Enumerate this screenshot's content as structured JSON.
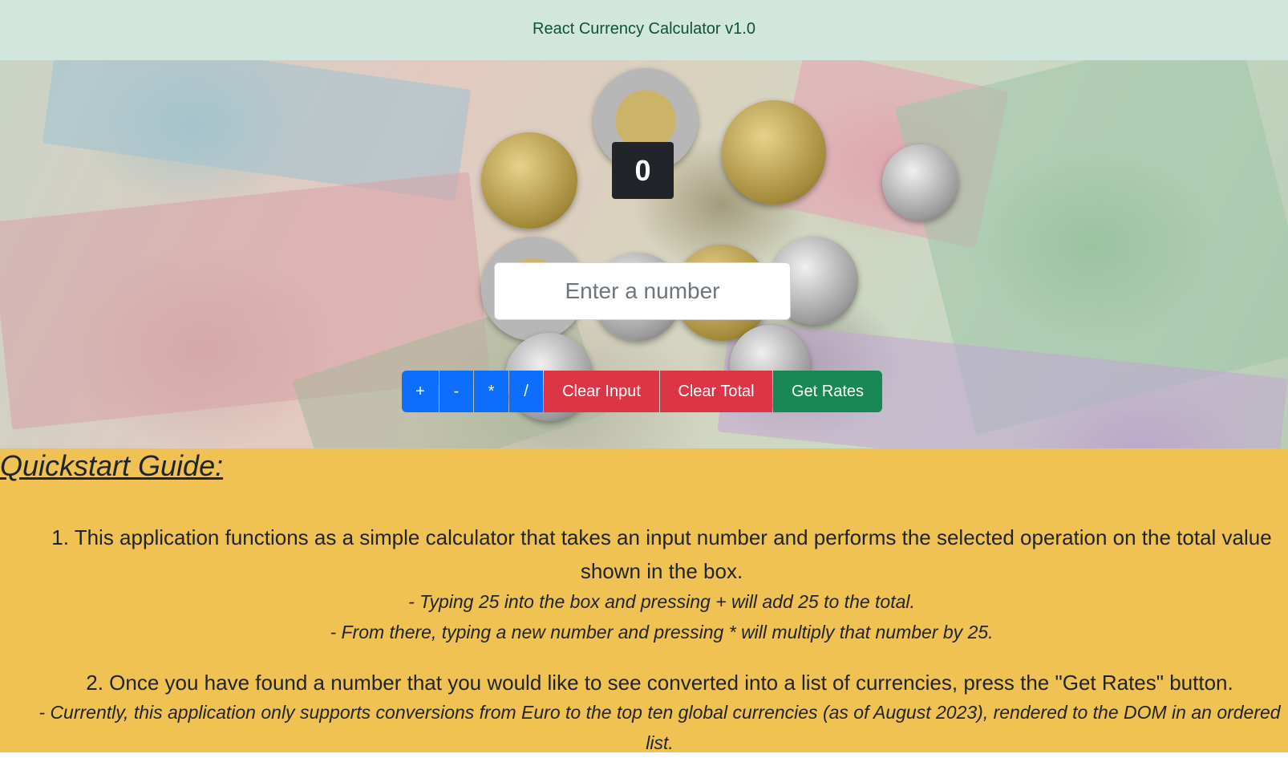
{
  "header": {
    "title": "React Currency Calculator v1.0"
  },
  "calculator": {
    "total": "0",
    "input_placeholder": "Enter a number",
    "input_value": "",
    "buttons": {
      "add": "+",
      "subtract": "-",
      "multiply": "*",
      "divide": "/",
      "clear_input": "Clear Input",
      "clear_total": "Clear Total",
      "get_rates": "Get Rates"
    }
  },
  "guide": {
    "heading": "Quickstart Guide:",
    "item1": "1. This application functions as a simple calculator that takes an input number and performs the selected operation on the total value shown in the box.",
    "item1_sub1": "- Typing 25 into the box and pressing + will add 25 to the total.",
    "item1_sub2": "- From there, typing a new number and pressing * will multiply that number by 25.",
    "item2": "2. Once you have found a number that you would like to see converted into a list of currencies, press the \"Get Rates\" button.",
    "item2_sub1": "- Currently, this application only supports conversions from Euro to the top ten global currencies (as of August 2023), rendered to the DOM in an ordered list."
  },
  "colors": {
    "header_bg": "#d1e7dd",
    "header_text": "#0f5132",
    "total_bg": "#212529",
    "operator_button": "#0d6efd",
    "clear_button": "#dc3545",
    "rates_button": "#198754",
    "guide_bg": "#f0c254"
  }
}
